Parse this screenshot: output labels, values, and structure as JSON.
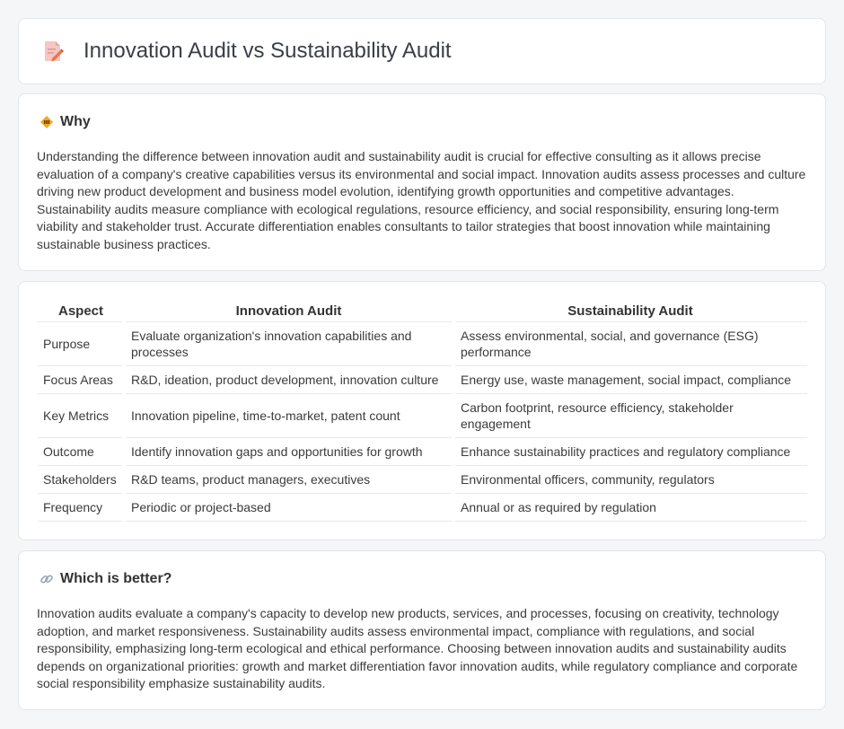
{
  "header": {
    "title": "Innovation Audit vs Sustainability Audit",
    "icon": "document-pencil-icon"
  },
  "why": {
    "heading": "Why",
    "icon": "diamond-warning-icon",
    "text": "Understanding the difference between innovation audit and sustainability audit is crucial for effective consulting as it allows precise evaluation of a company's creative capabilities versus its environmental and social impact. Innovation audits assess processes and culture driving new product development and business model evolution, identifying growth opportunities and competitive advantages. Sustainability audits measure compliance with ecological regulations, resource efficiency, and social responsibility, ensuring long-term viability and stakeholder trust. Accurate differentiation enables consultants to tailor strategies that boost innovation while maintaining sustainable business practices."
  },
  "table": {
    "headers": [
      "Aspect",
      "Innovation Audit",
      "Sustainability Audit"
    ],
    "rows": [
      [
        "Purpose",
        "Evaluate organization's innovation capabilities and processes",
        "Assess environmental, social, and governance (ESG) performance"
      ],
      [
        "Focus Areas",
        "R&D, ideation, product development, innovation culture",
        "Energy use, waste management, social impact, compliance"
      ],
      [
        "Key Metrics",
        "Innovation pipeline, time-to-market, patent count",
        "Carbon footprint, resource efficiency, stakeholder engagement"
      ],
      [
        "Outcome",
        "Identify innovation gaps and opportunities for growth",
        "Enhance sustainability practices and regulatory compliance"
      ],
      [
        "Stakeholders",
        "R&D teams, product managers, executives",
        "Environmental officers, community, regulators"
      ],
      [
        "Frequency",
        "Periodic or project-based",
        "Annual or as required by regulation"
      ]
    ]
  },
  "better": {
    "heading": "Which is better?",
    "icon": "link-icon",
    "text": "Innovation audits evaluate a company's capacity to develop new products, services, and processes, focusing on creativity, technology adoption, and market responsiveness. Sustainability audits assess environmental impact, compliance with regulations, and social responsibility, emphasizing long-term ecological and ethical performance. Choosing between innovation audits and sustainability audits depends on organizational priorities: growth and market differentiation favor innovation audits, while regulatory compliance and corporate social responsibility emphasize sustainability audits."
  }
}
